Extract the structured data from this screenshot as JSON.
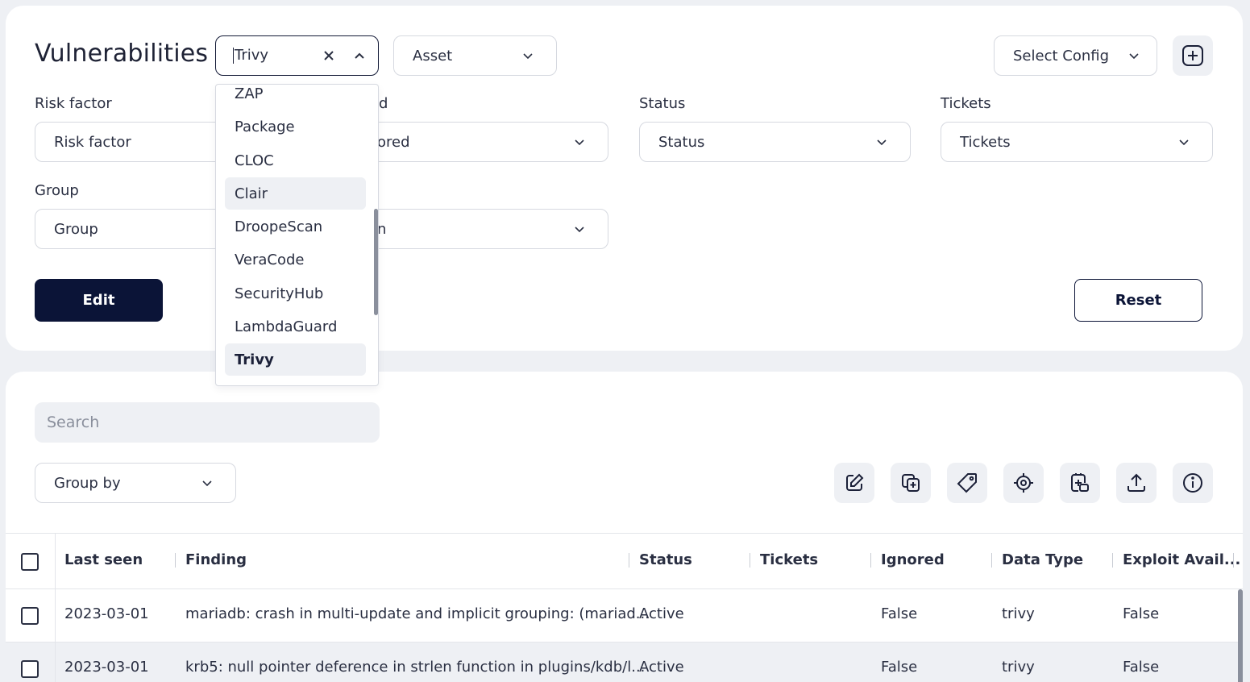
{
  "header": {
    "title": "Vulnerabilities",
    "scanner_select": {
      "value": "Trivy"
    },
    "asset_select": {
      "value": "Asset"
    },
    "config_select": {
      "value": "Select Config"
    }
  },
  "filters": {
    "risk_factor": {
      "label": "Risk factor",
      "value": "Risk factor"
    },
    "ignored": {
      "label_partial": "d",
      "value_partial": "ored"
    },
    "status": {
      "label": "Status",
      "value": "Status"
    },
    "tickets": {
      "label": "Tickets",
      "value": "Tickets"
    },
    "group": {
      "label": "Group",
      "value": "Group"
    },
    "second_partial": {
      "value_partial": "n"
    }
  },
  "buttons": {
    "edit": "Edit",
    "reset": "Reset"
  },
  "dropdown": {
    "items": [
      "ZAP",
      "Package",
      "CLOC",
      "Clair",
      "DroopeScan",
      "VeraCode",
      "SecurityHub",
      "LambdaGuard",
      "Trivy"
    ],
    "hovered": "Clair",
    "selected": "Trivy"
  },
  "search": {
    "placeholder": "Search"
  },
  "group_by": {
    "value": "Group by"
  },
  "toolbar_icons": [
    "edit-icon",
    "duplicate-icon",
    "tag-icon",
    "target-icon",
    "add-ticket-icon",
    "upload-icon",
    "info-icon"
  ],
  "table": {
    "columns": [
      "Last seen",
      "Finding",
      "Status",
      "Tickets",
      "Ignored",
      "Data Type",
      "Exploit Avail..."
    ],
    "rows": [
      {
        "last_seen": "2023-03-01",
        "finding": "mariadb: crash in multi-update and implicit grouping: (mariad...",
        "status": "Active",
        "tickets": "",
        "ignored": "False",
        "data_type": "trivy",
        "exploit": "False"
      },
      {
        "last_seen": "2023-03-01",
        "finding": "krb5: null pointer deference in strlen function in plugins/kdb/l...",
        "status": "Active",
        "tickets": "",
        "ignored": "False",
        "data_type": "trivy",
        "exploit": "False"
      }
    ]
  },
  "colors": {
    "primary": "#0b1437",
    "background": "#eef0f4",
    "border": "#d6d9e0"
  }
}
